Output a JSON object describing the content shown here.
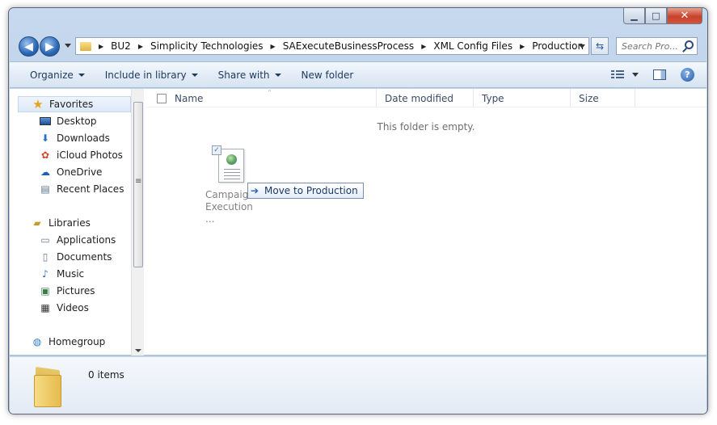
{
  "window": {
    "caption": {
      "minimize": "▁",
      "maximize": "□",
      "close": "✕"
    }
  },
  "address_bar": {
    "back_icon": "back-arrow-icon",
    "forward_icon": "forward-arrow-icon",
    "back_glyph": "◀",
    "forward_glyph": "▶",
    "crumbs": [
      "BU2",
      "Simplicity Technologies",
      "SAExecuteBusinessProcess",
      "XML Config Files",
      "Production"
    ],
    "separator": "▶",
    "refresh_glyph": "⇆",
    "search_placeholder": "Search Pro..."
  },
  "toolbar": {
    "organize": "Organize",
    "include_in_library": "Include in library",
    "share_with": "Share with",
    "new_folder": "New folder",
    "help_glyph": "?"
  },
  "nav_pane": {
    "favorites": {
      "label": "Favorites",
      "items": [
        "Desktop",
        "Downloads",
        "iCloud Photos",
        "OneDrive",
        "Recent Places"
      ]
    },
    "libraries": {
      "label": "Libraries",
      "items": [
        "Applications",
        "Documents",
        "Music",
        "Pictures",
        "Videos"
      ]
    },
    "homegroup": {
      "label": "Homegroup"
    }
  },
  "file_list": {
    "columns": {
      "name": "Name",
      "date_modified": "Date modified",
      "type": "Type",
      "size": "Size"
    },
    "sort_glyph": "⌃",
    "empty_message": "This folder is empty.",
    "dragged_item": {
      "label_line1": "Campaign",
      "label_line2": "Execution ...",
      "check_glyph": "✓"
    },
    "drop_tip": {
      "arrow_glyph": "➔",
      "text": "Move to Production"
    }
  },
  "details_pane": {
    "count": "0 items"
  },
  "colors": {
    "frame": "#b5cbe5",
    "toolbar_text": "#1e395b",
    "accent_blue": "#2a66b5",
    "folder_yellow": "#e6bb4d"
  }
}
